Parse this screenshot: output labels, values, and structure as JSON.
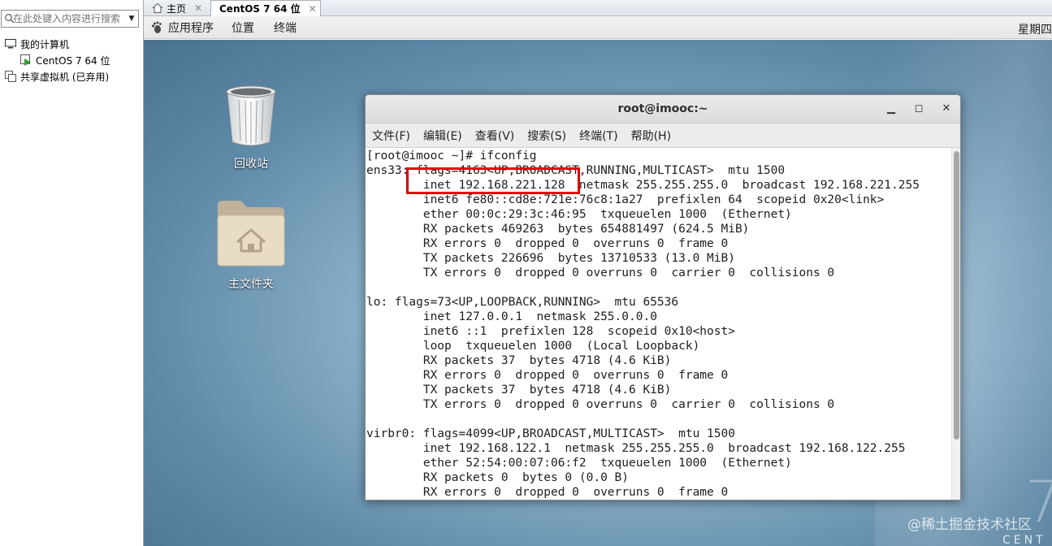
{
  "library": {
    "search_placeholder": "在此处键入内容进行搜索",
    "tree": {
      "my_computer": "我的计算机",
      "vm_name": "CentOS 7 64 位",
      "shared_vms": "共享虚拟机 (已弃用)"
    }
  },
  "tabs": [
    {
      "label": "主页",
      "close": "✕"
    },
    {
      "label": "CentOS 7 64 位",
      "close": "✕"
    }
  ],
  "gnome": {
    "menu": [
      "应用程序",
      "位置",
      "终端"
    ],
    "clock": "星期四"
  },
  "desktop": {
    "icons": [
      "回收站",
      "主文件夹"
    ],
    "watermark": "@稀土掘金技术社区",
    "logo_text": "CENT",
    "logo_numeral": "7"
  },
  "terminal": {
    "title": "root@imooc:~",
    "menu": [
      "文件(F)",
      "编辑(E)",
      "查看(V)",
      "搜索(S)",
      "终端(T)",
      "帮助(H)"
    ],
    "lines": [
      "[root@imooc ~]# ifconfig",
      "ens33: flags=4163<UP,BROADCAST,RUNNING,MULTICAST>  mtu 1500",
      "        inet 192.168.221.128  netmask 255.255.255.0  broadcast 192.168.221.255",
      "        inet6 fe80::cd8e:721e:76c8:1a27  prefixlen 64  scopeid 0x20<link>",
      "        ether 00:0c:29:3c:46:95  txqueuelen 1000  (Ethernet)",
      "        RX packets 469263  bytes 654881497 (624.5 MiB)",
      "        RX errors 0  dropped 0  overruns 0  frame 0",
      "        TX packets 226696  bytes 13710533 (13.0 MiB)",
      "        TX errors 0  dropped 0 overruns 0  carrier 0  collisions 0",
      "",
      "lo: flags=73<UP,LOOPBACK,RUNNING>  mtu 65536",
      "        inet 127.0.0.1  netmask 255.0.0.0",
      "        inet6 ::1  prefixlen 128  scopeid 0x10<host>",
      "        loop  txqueuelen 1000  (Local Loopback)",
      "        RX packets 37  bytes 4718 (4.6 KiB)",
      "        RX errors 0  dropped 0  overruns 0  frame 0",
      "        TX packets 37  bytes 4718 (4.6 KiB)",
      "        TX errors 0  dropped 0 overruns 0  carrier 0  collisions 0",
      "",
      "virbr0: flags=4099<UP,BROADCAST,MULTICAST>  mtu 1500",
      "        inet 192.168.122.1  netmask 255.255.255.0  broadcast 192.168.122.255",
      "        ether 52:54:00:07:06:f2  txqueuelen 1000  (Ethernet)",
      "        RX packets 0  bytes 0 (0.0 B)",
      "        RX errors 0  dropped 0  overruns 0  frame 0"
    ],
    "window_buttons": {
      "minimize": "▁",
      "maximize": "◻",
      "close": "✕"
    }
  },
  "colors": {
    "highlight": "#e00000",
    "terminal_text": "#202020"
  }
}
